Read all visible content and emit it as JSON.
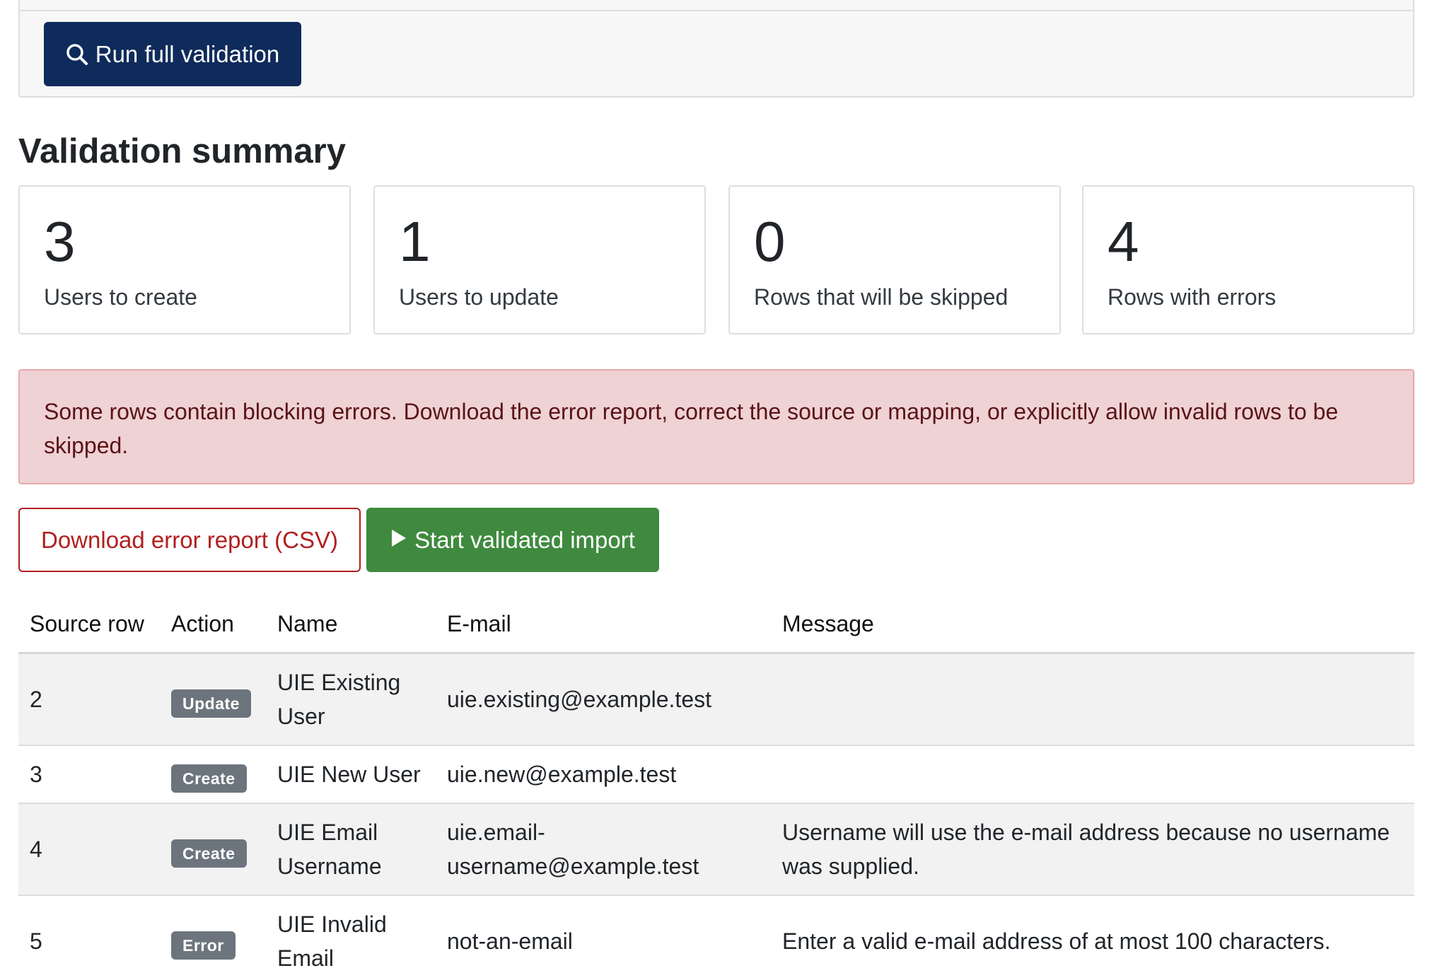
{
  "toolbar": {
    "run_label": "Run full validation"
  },
  "summary": {
    "title": "Validation summary",
    "stats": [
      {
        "value": "3",
        "label": "Users to create"
      },
      {
        "value": "1",
        "label": "Users to update"
      },
      {
        "value": "0",
        "label": "Rows that will be skipped"
      },
      {
        "value": "4",
        "label": "Rows with errors"
      }
    ]
  },
  "alert": {
    "text": "Some rows contain blocking errors. Download the error report, correct the source or mapping, or explicitly allow invalid rows to be skipped."
  },
  "actions": {
    "download_label": "Download error report (CSV)",
    "start_label": "Start validated import"
  },
  "table": {
    "headers": [
      "Source row",
      "Action",
      "Name",
      "E-mail",
      "Message"
    ],
    "rows": [
      {
        "row": "2",
        "action": "Update",
        "name": "UIE Existing User",
        "email": "uie.existing@example.test",
        "message": ""
      },
      {
        "row": "3",
        "action": "Create",
        "name": "UIE New User",
        "email": "uie.new@example.test",
        "message": ""
      },
      {
        "row": "4",
        "action": "Create",
        "name": "UIE Email Username",
        "email": "uie.email-username@example.test",
        "message": "Username will use the e-mail address because no username was supplied."
      },
      {
        "row": "5",
        "action": "Error",
        "name": "UIE Invalid Email",
        "email": "not-an-email",
        "message": "Enter a valid e-mail address of at most 100 characters."
      }
    ]
  },
  "icons": {
    "run": "search-icon",
    "start": "play-icon"
  },
  "colors": {
    "primary": "#0f2b5b",
    "success": "#3f8a3f",
    "danger": "#b0201f",
    "alert_bg": "#efd2d3",
    "badge": "#6c757d"
  }
}
